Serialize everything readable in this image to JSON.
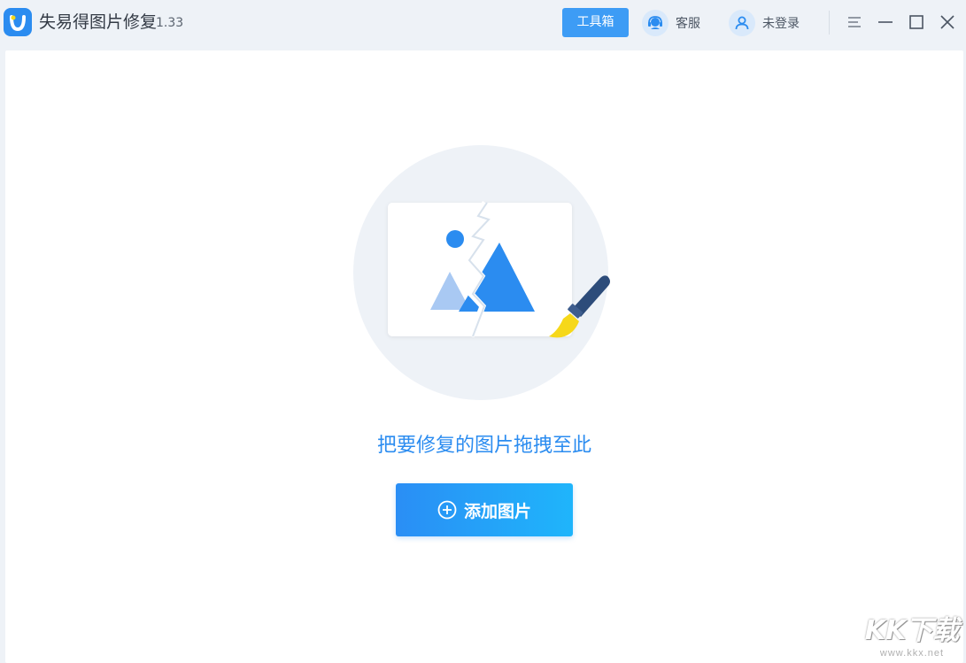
{
  "titlebar": {
    "app_name": "失易得图片修复",
    "version": "1.33",
    "toolbox_label": "工具箱",
    "support_label": "客服",
    "login_label": "未登录",
    "icons": {
      "logo": "app-logo-icon",
      "support": "headset-icon",
      "user": "user-icon",
      "menu": "menu-icon",
      "minimize": "minimize-icon",
      "maximize": "maximize-icon",
      "close": "close-icon"
    }
  },
  "main": {
    "illustration_icon": "broken-image-with-brush-icon",
    "drop_hint": "把要修复的图片拖拽至此",
    "add_button_label": "添加图片",
    "add_icon": "plus-circle-icon"
  },
  "watermark": {
    "text": "KK下载",
    "url": "www.kkx.net"
  },
  "colors": {
    "accent": "#2b8cf0",
    "toolbox_bg": "#3d9cf5",
    "brush_handle": "#2d4c7a",
    "brush_tip": "#f6d81a",
    "illus_bg": "#eef2f7"
  }
}
